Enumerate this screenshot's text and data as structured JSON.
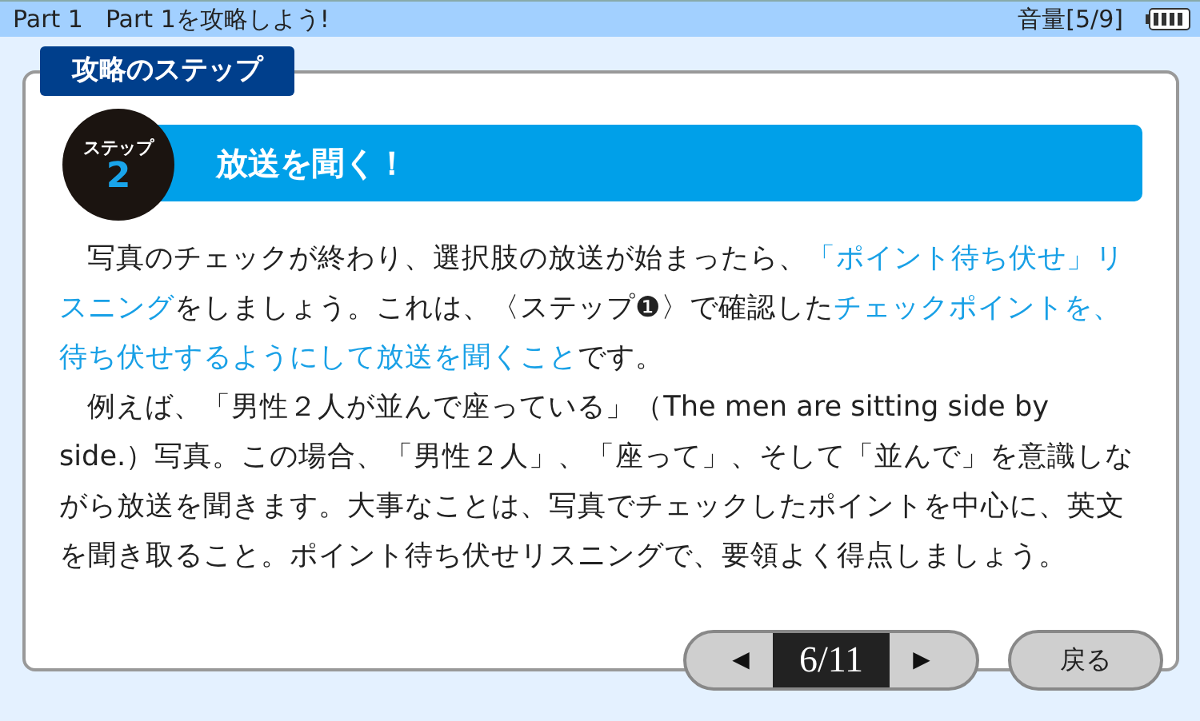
{
  "header": {
    "part": "Part 1",
    "title": "Part 1を攻略しよう!",
    "volume": "音量[5/9]"
  },
  "section_tab": "攻略のステップ",
  "step": {
    "label": "ステップ",
    "number": "2",
    "title": "放送を聞く！"
  },
  "paragraphs": [
    {
      "segments": [
        {
          "text": "写真のチェックが終わり、選択肢の放送が始まったら、",
          "highlight": false
        },
        {
          "text": "「ポイント待ち伏せ」リスニング",
          "highlight": true
        },
        {
          "text": "をしましょう。これは、〈ステップ❶〉で確認した",
          "highlight": false
        },
        {
          "text": "チェックポイントを、待ち伏せするようにして放送を聞くこと",
          "highlight": true
        },
        {
          "text": "です。",
          "highlight": false
        }
      ]
    },
    {
      "segments": [
        {
          "text": "例えば、「男性２人が並んで座っている」（The men are sitting side by side.）写真。この場合、「男性２人」、「座って」、そして「並んで」を意識しながら放送を聞きます。大事なことは、写真でチェックしたポイントを中心に、英文を聞き取ること。ポイント待ち伏せリスニングで、要領よく得点しましょう。",
          "highlight": false
        }
      ]
    }
  ],
  "pager": {
    "prev": "◀",
    "page": "6/11",
    "next": "▶"
  },
  "back_button": "戻る"
}
